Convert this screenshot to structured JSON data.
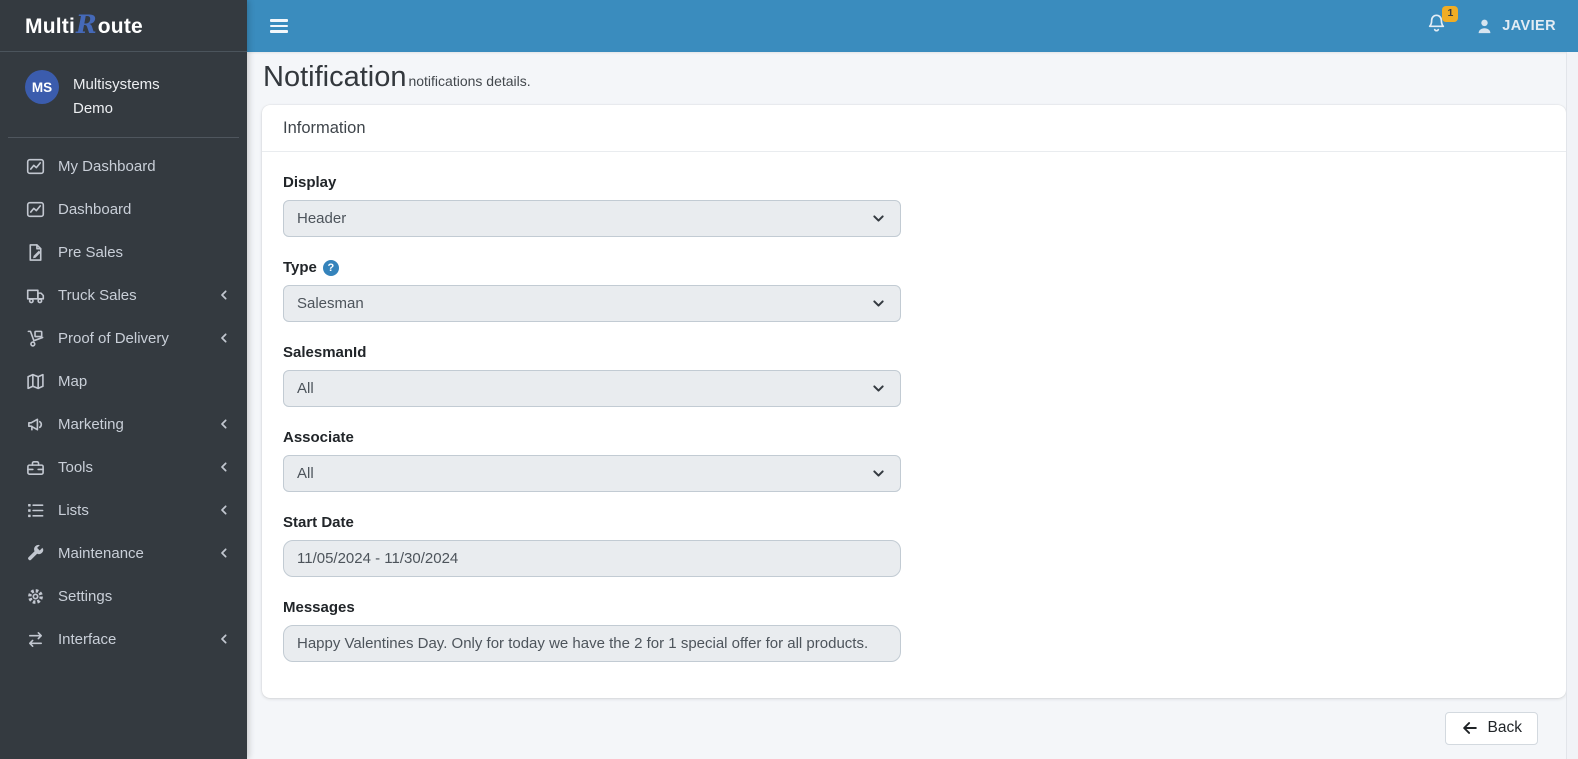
{
  "brand": {
    "prefix": "Multi",
    "accent": "R",
    "suffix": "oute"
  },
  "user_panel": {
    "initials": "MS",
    "name": "Multisystems Demo"
  },
  "sidebar": {
    "items": [
      {
        "label": "My Dashboard",
        "icon": "chart-line-icon",
        "expandable": false
      },
      {
        "label": "Dashboard",
        "icon": "chart-line-icon",
        "expandable": false
      },
      {
        "label": "Pre Sales",
        "icon": "file-pen-icon",
        "expandable": false
      },
      {
        "label": "Truck Sales",
        "icon": "truck-icon",
        "expandable": true
      },
      {
        "label": "Proof of Delivery",
        "icon": "dolly-icon",
        "expandable": true
      },
      {
        "label": "Map",
        "icon": "map-icon",
        "expandable": false
      },
      {
        "label": "Marketing",
        "icon": "bullhorn-icon",
        "expandable": true
      },
      {
        "label": "Tools",
        "icon": "toolbox-icon",
        "expandable": true
      },
      {
        "label": "Lists",
        "icon": "list-icon",
        "expandable": true
      },
      {
        "label": "Maintenance",
        "icon": "wrench-icon",
        "expandable": true
      },
      {
        "label": "Settings",
        "icon": "gear-icon",
        "expandable": false
      },
      {
        "label": "Interface",
        "icon": "exchange-icon",
        "expandable": true
      }
    ]
  },
  "navbar": {
    "notification_count": "1",
    "username": "JAVIER"
  },
  "page": {
    "title": "Notification",
    "subtitle": "notifications details."
  },
  "card": {
    "header": "Information",
    "fields": [
      {
        "label": "Display",
        "type": "select",
        "value": "Header",
        "help": false
      },
      {
        "label": "Type",
        "type": "select",
        "value": "Salesman",
        "help": true
      },
      {
        "label": "SalesmanId",
        "type": "select",
        "value": "All",
        "help": false
      },
      {
        "label": "Associate",
        "type": "select",
        "value": "All",
        "help": false
      },
      {
        "label": "Start Date",
        "type": "input",
        "value": "11/05/2024 - 11/30/2024",
        "help": false
      },
      {
        "label": "Messages",
        "type": "input",
        "value": "Happy Valentines Day. Only for today we have the 2 for 1 special offer for all products.",
        "help": false
      }
    ]
  },
  "footer": {
    "back_label": "Back"
  },
  "colors": {
    "navbar_blue": "#3a8cbe",
    "sidebar_dark": "#343a40",
    "badge_yellow": "#f0ad24",
    "avatar_blue": "#3b5cad",
    "help_blue": "#3583bb",
    "page_bg": "#f4f6f9",
    "control_bg": "#e9ecef"
  }
}
